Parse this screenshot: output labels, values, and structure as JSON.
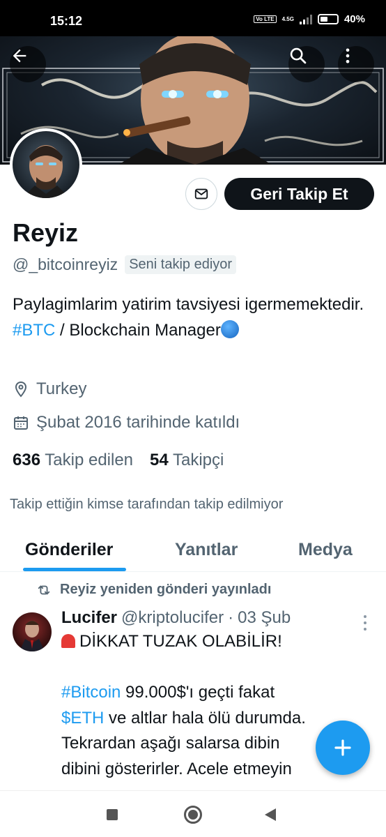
{
  "status_bar": {
    "time": "15:12",
    "volte": "Vo LTE",
    "network": "4.5G",
    "battery": "40%"
  },
  "profile": {
    "name": "Reyiz",
    "handle": "@_bitcoinreyiz",
    "follows_you": "Seni takip ediyor",
    "follow_button": "Geri Takip Et",
    "bio": {
      "part1": "Paylagimlarim yatirim tavsiyesi igermemektedir. ",
      "hashtag": "#BTC",
      "part2": " / Blockchain Manager"
    },
    "location": "Turkey",
    "joined": "Şubat 2016 tarihinde katıldı",
    "following_count": "636",
    "following_label": "Takip edilen",
    "followers_count": "54",
    "followers_label": "Takipçi",
    "not_followed_note": "Takip ettiğin kimse tarafından takip edilmiyor"
  },
  "tabs": [
    "Gönderiler",
    "Yanıtlar",
    "Medya"
  ],
  "post": {
    "repost_label": "Reyiz yeniden gönderi yayınladı",
    "author_name": "Lucifer",
    "author_handle": "@kriptolucifer",
    "separator": "·",
    "date": "03 Şub",
    "line1": "DİKKAT TUZAK OLABİLİR!",
    "hashtag1": "#Bitcoin",
    "line2_rest": " 99.000$'ı geçti fakat",
    "cashtag": "$ETH",
    "line3_rest": " ve altlar hala ölü durumda.",
    "line4": "Tekrardan aşağı salarsa dibin",
    "line5": "dibini gösterirler. Acele etmeyin"
  },
  "colors": {
    "accent": "#1d9bf0",
    "text": "#0f1419",
    "secondary": "#536471"
  },
  "icons": {
    "back": "arrow-left-icon",
    "search": "search-icon",
    "more": "more-vertical-icon",
    "message": "mail-icon",
    "location": "location-pin-icon",
    "calendar": "calendar-icon",
    "repost": "repost-icon",
    "compose": "plus-icon"
  }
}
